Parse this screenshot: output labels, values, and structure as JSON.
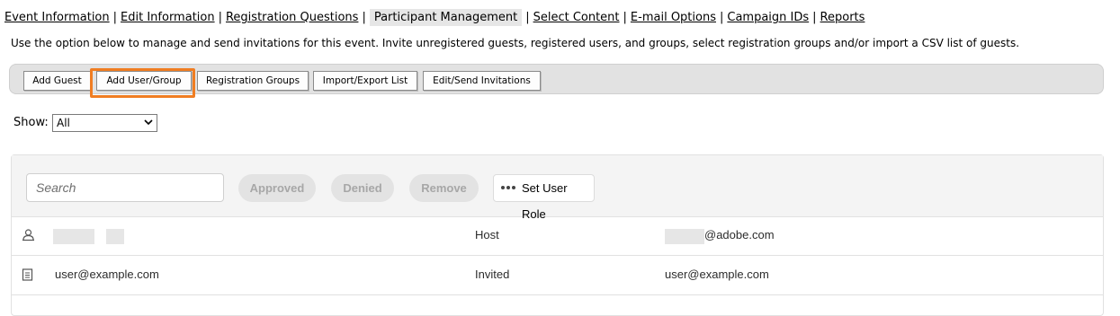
{
  "nav": {
    "items": [
      {
        "label": "Event Information"
      },
      {
        "label": "Edit Information"
      },
      {
        "label": "Registration Questions"
      },
      {
        "label": "Participant Management"
      },
      {
        "label": "Select Content"
      },
      {
        "label": "E-mail Options"
      },
      {
        "label": "Campaign IDs"
      },
      {
        "label": "Reports"
      }
    ],
    "separator": "|"
  },
  "intro": "Use the option below to manage and send invitations for this event. Invite unregistered guests, registered users, and groups, select registration groups and/or import a CSV list of guests.",
  "toolbar": {
    "add_guest": "Add Guest",
    "add_user_group": "Add User/Group",
    "registration_groups": "Registration Groups",
    "import_export": "Import/Export List",
    "edit_send": "Edit/Send Invitations"
  },
  "show": {
    "label": "Show:",
    "value": "All"
  },
  "panel": {
    "search_placeholder": "Search",
    "approved": "Approved",
    "denied": "Denied",
    "remove": "Remove",
    "set_role": "Set User Role"
  },
  "rows": [
    {
      "name": "",
      "status": "Host",
      "email": "@adobe.com",
      "icon": "host-icon"
    },
    {
      "name": "user@example.com",
      "status": "Invited",
      "email": "user@example.com",
      "icon": "invite-icon"
    }
  ],
  "colors": {
    "highlight": "#f07d22",
    "toolbar_bg": "#e2e2e2"
  }
}
